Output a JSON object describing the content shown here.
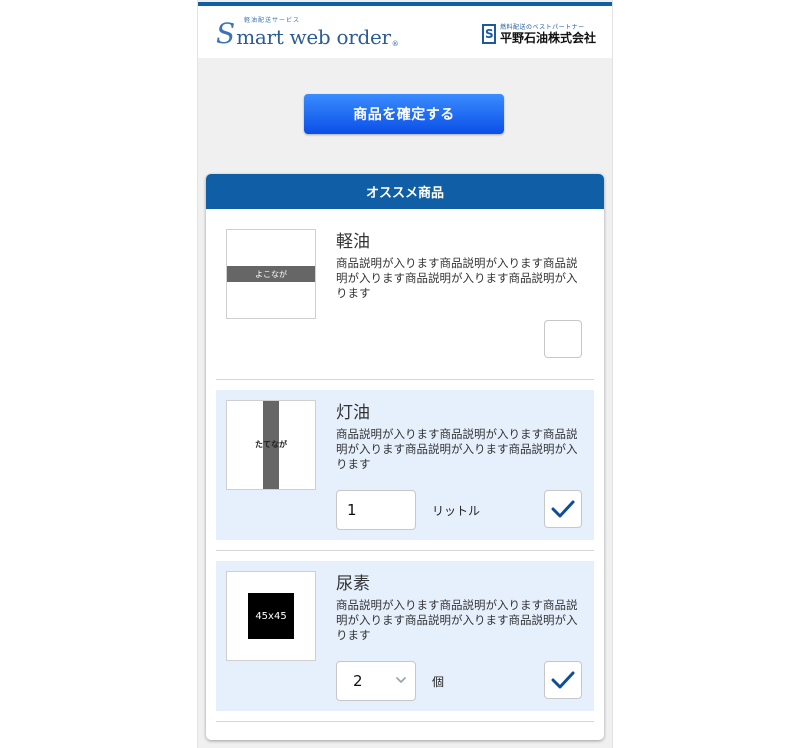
{
  "header": {
    "logo_tagline": "軽油配送サービス",
    "logo_s": "S",
    "logo_text": "mart web order",
    "logo_reg": "®",
    "company_tagline": "燃料配送のベストパートナー",
    "company_mark": "S",
    "company_name": "平野石油株式会社"
  },
  "confirm_button": {
    "label": "商品を確定する"
  },
  "recommend": {
    "title": "オススメ商品",
    "items": [
      {
        "name": "軽油",
        "description": "商品説明が入ります商品説明が入ります商品説明が入ります商品説明が入ります商品説明が入ります",
        "thumb_label": "よこなが",
        "checked": false
      },
      {
        "name": "灯油",
        "description": "商品説明が入ります商品説明が入ります商品説明が入ります商品説明が入ります商品説明が入ります",
        "thumb_label": "たてなが",
        "quantity": "1",
        "unit": "リットル",
        "checked": true
      },
      {
        "name": "尿素",
        "description": "商品説明が入ります商品説明が入ります商品説明が入ります商品説明が入ります商品説明が入ります",
        "thumb_label": "45x45",
        "quantity": "2",
        "unit": "個",
        "checked": true
      }
    ]
  },
  "colors": {
    "brand_blue": "#0f5ea6",
    "button_blue": "#1a66f2",
    "selected_bg": "#e6f0fd",
    "check_blue": "#0f4c9c"
  },
  "icons": {
    "check": "checkmark-icon",
    "select": "chevron-down-icon"
  }
}
